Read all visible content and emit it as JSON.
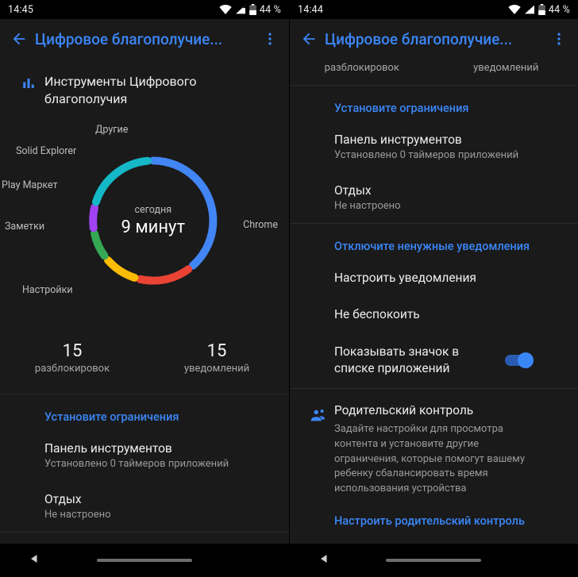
{
  "left": {
    "status": {
      "time": "14:45",
      "battery": "44 %"
    },
    "appbar": {
      "title": "Цифровое благополучие..."
    },
    "header": "Инструменты Цифрового благополучия",
    "chart": {
      "centerTop": "сегодня",
      "centerMain": "9 минут",
      "labels": {
        "chrome": "Chrome",
        "settings": "Настройки",
        "notes": "Заметки",
        "play": "Play Маркет",
        "solid": "Solid Explorer",
        "others": "Другие"
      }
    },
    "stats": {
      "unlocksNum": "15",
      "unlocksCap": "разблокировок",
      "notifNum": "15",
      "notifCap": "уведомлений"
    },
    "sec1": "Установите ограничения",
    "dash": {
      "t": "Панель инструментов",
      "s": "Установлено 0 таймеров приложений"
    },
    "rest": {
      "t": "Отдых",
      "s": "Не настроено"
    },
    "sec2": "Отключите ненужные уведомления"
  },
  "right": {
    "status": {
      "time": "14:44",
      "battery": "44 %"
    },
    "appbar": {
      "title": "Цифровое благополучие..."
    },
    "topCaps": {
      "unlocks": "разблокировок",
      "notif": "уведомлений"
    },
    "sec1": "Установите ограничения",
    "dash": {
      "t": "Панель инструментов",
      "s": "Установлено 0 таймеров приложений"
    },
    "rest": {
      "t": "Отдых",
      "s": "Не настроено"
    },
    "sec2": "Отключите ненужные уведомления",
    "manageNotif": "Настроить уведомления",
    "dnd": "Не беспокоить",
    "showIcon": "Показывать значок в списке приложений",
    "parental": {
      "title": "Родительский контроль",
      "desc": "Задайте настройки для просмотра контента и установите другие ограничения, которые помогут вашему ребенку сбалансировать время использования устройства",
      "link": "Настроить родительский контроль"
    }
  },
  "chart_data": {
    "type": "pie",
    "title": "сегодня — 9 минут",
    "series": [
      {
        "name": "Chrome",
        "value": 40,
        "color": "#4285F4"
      },
      {
        "name": "Настройки",
        "value": 15,
        "color": "#EA4335"
      },
      {
        "name": "Заметки",
        "value": 10,
        "color": "#FBBC05"
      },
      {
        "name": "Play Маркет",
        "value": 8,
        "color": "#34A853"
      },
      {
        "name": "Solid Explorer",
        "value": 7,
        "color": "#A142F4"
      },
      {
        "name": "Другие",
        "value": 20,
        "color": "#14B8C7"
      }
    ]
  }
}
